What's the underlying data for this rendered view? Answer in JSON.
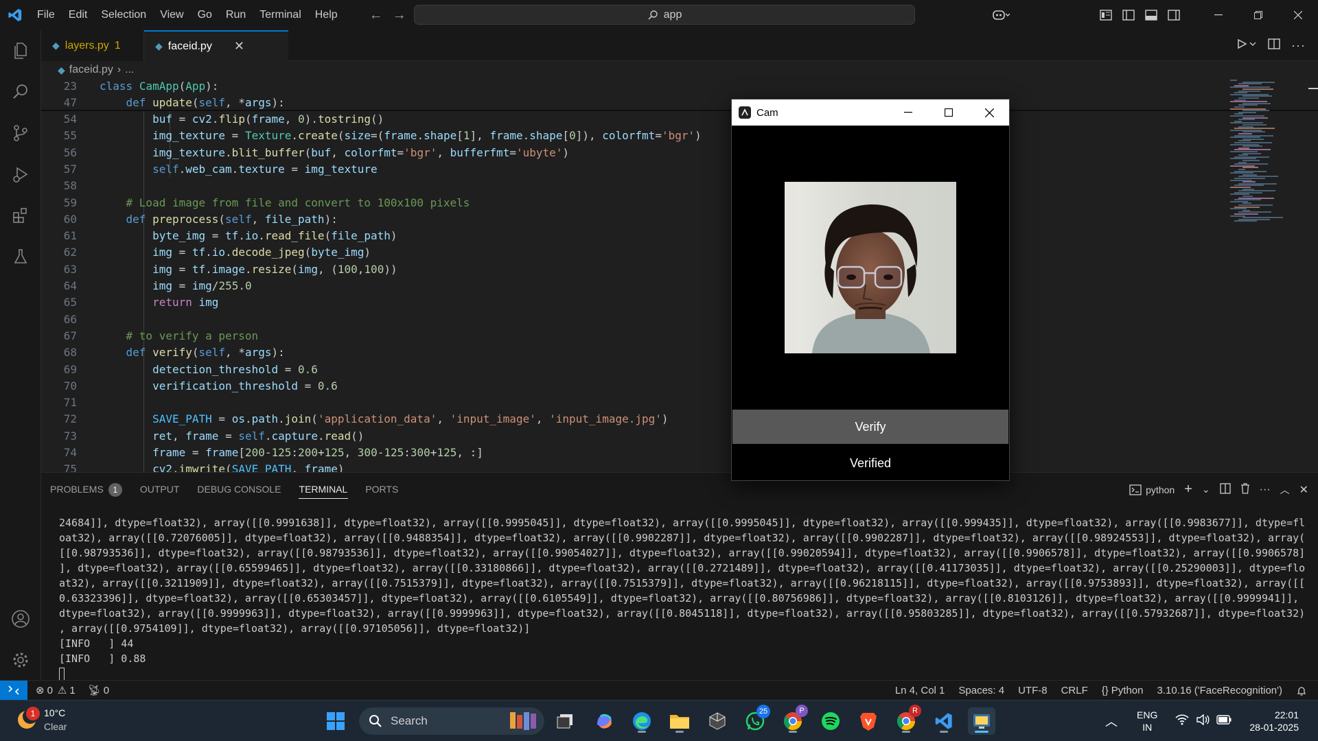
{
  "titlebar": {
    "menu": [
      "File",
      "Edit",
      "Selection",
      "View",
      "Go",
      "Run",
      "Terminal",
      "Help"
    ],
    "search_text": "app"
  },
  "tabs": [
    {
      "label": "layers.py",
      "problems": "1"
    },
    {
      "label": "faceid.py"
    }
  ],
  "breadcrumb": {
    "file": "faceid.py",
    "more": "..."
  },
  "editor": {
    "lines": [
      {
        "n": "23",
        "t": "class CamApp(App):"
      },
      {
        "n": "47",
        "t": "    def update(self, *args):"
      },
      {
        "n": "54",
        "t": "        buf = cv2.flip(frame, 0).tostring()"
      },
      {
        "n": "55",
        "t": "        img_texture = Texture.create(size=(frame.shape[1], frame.shape[0]), colorfmt='bgr')"
      },
      {
        "n": "56",
        "t": "        img_texture.blit_buffer(buf, colorfmt='bgr', bufferfmt='ubyte')"
      },
      {
        "n": "57",
        "t": "        self.web_cam.texture = img_texture"
      },
      {
        "n": "58",
        "t": ""
      },
      {
        "n": "59",
        "t": "    # Load image from file and convert to 100x100 pixels"
      },
      {
        "n": "60",
        "t": "    def preprocess(self, file_path):"
      },
      {
        "n": "61",
        "t": "        byte_img = tf.io.read_file(file_path)"
      },
      {
        "n": "62",
        "t": "        img = tf.io.decode_jpeg(byte_img)"
      },
      {
        "n": "63",
        "t": "        img = tf.image.resize(img, (100,100))"
      },
      {
        "n": "64",
        "t": "        img = img/255.0"
      },
      {
        "n": "65",
        "t": "        return img"
      },
      {
        "n": "66",
        "t": ""
      },
      {
        "n": "67",
        "t": "    # to verify a person"
      },
      {
        "n": "68",
        "t": "    def verify(self, *args):"
      },
      {
        "n": "69",
        "t": "        detection_threshold = 0.6"
      },
      {
        "n": "70",
        "t": "        verification_threshold = 0.6"
      },
      {
        "n": "71",
        "t": ""
      },
      {
        "n": "72",
        "t": "        SAVE_PATH = os.path.join('application_data', 'input_image', 'input_image.jpg')"
      },
      {
        "n": "73",
        "t": "        ret, frame = self.capture.read()"
      },
      {
        "n": "74",
        "t": "        frame = frame[200-125:200+125, 300-125:300+125, :]"
      },
      {
        "n": "75",
        "t": "        cv2.imwrite(SAVE_PATH, frame)"
      }
    ]
  },
  "panel": {
    "tabs": [
      "PROBLEMS",
      "OUTPUT",
      "DEBUG CONSOLE",
      "TERMINAL",
      "PORTS"
    ],
    "problems_count": "1",
    "shell": "python",
    "terminal_lines": [
      "24684]], dtype=float32), array([[0.9991638]], dtype=float32), array([[0.9995045]], dtype=float32), array([[0.9995045]], dtype=float32), array([[0.999435]], dtype=float32), array([[0.9983677]], dtype=fl",
      "oat32), array([[0.72076005]], dtype=float32), array([[0.9488354]], dtype=float32), array([[0.9902287]], dtype=float32), array([[0.9902287]], dtype=float32), array([[0.98924553]], dtype=float32), array(",
      "[[0.98793536]], dtype=float32), array([[0.98793536]], dtype=float32), array([[0.99054027]], dtype=float32), array([[0.99020594]], dtype=float32), array([[0.9906578]], dtype=float32), array([[0.9906578]",
      "], dtype=float32), array([[0.65599465]], dtype=float32), array([[0.33180866]], dtype=float32), array([[0.2721489]], dtype=float32), array([[0.41173035]], dtype=float32), array([[0.25290003]], dtype=flo",
      "at32), array([[0.3211909]], dtype=float32), array([[0.7515379]], dtype=float32), array([[0.7515379]], dtype=float32), array([[0.96218115]], dtype=float32), array([[0.9753893]], dtype=float32), array([[",
      "0.63323396]], dtype=float32), array([[0.65303457]], dtype=float32), array([[0.6105549]], dtype=float32), array([[0.80756986]], dtype=float32), array([[0.8103126]], dtype=float32), array([[0.9999941]],",
      "dtype=float32), array([[0.9999963]], dtype=float32), array([[0.9999963]], dtype=float32), array([[0.8045118]], dtype=float32), array([[0.95803285]], dtype=float32), array([[0.57932687]], dtype=float32)",
      ", array([[0.9754109]], dtype=float32), array([[0.97105056]], dtype=float32)]",
      "[INFO   ] 44",
      "[INFO   ] 0.88"
    ]
  },
  "statusbar": {
    "errors": "0",
    "warnings": "1",
    "ports": "0",
    "position": "Ln 4, Col 1",
    "spaces": "Spaces: 4",
    "encoding": "UTF-8",
    "eol": "CRLF",
    "language": "Python",
    "interpreter": "3.10.16 ('FaceRecognition')"
  },
  "cam_window": {
    "title": "Cam",
    "button_label": "Verify",
    "status_text": "Verified"
  },
  "taskbar": {
    "weather_temp": "10°C",
    "weather_desc": "Clear",
    "weather_badge": "1",
    "search_label": "Search",
    "whatsapp_badge": "25",
    "lang_top": "ENG",
    "lang_bottom": "IN",
    "time": "22:01",
    "date": "28-01-2025"
  },
  "colors": {
    "accent": "#0078d4",
    "keyword": "#c586c0",
    "storage": "#569cd6",
    "function": "#dcdcaa",
    "class": "#4ec9b0",
    "string": "#ce9178",
    "comment": "#6a9955",
    "number": "#b5cea8",
    "variable": "#9cdcfe"
  }
}
